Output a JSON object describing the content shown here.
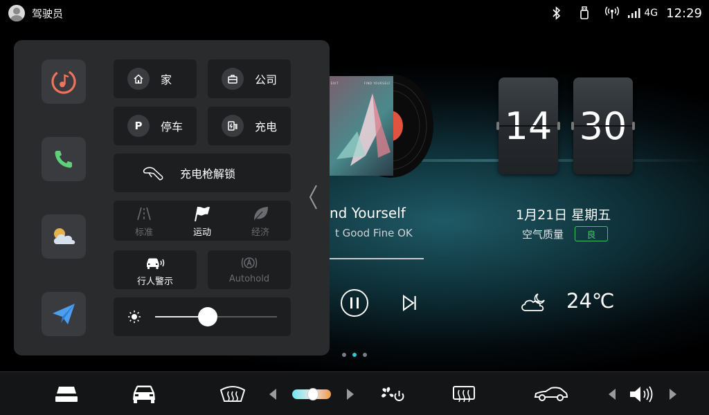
{
  "status_bar": {
    "user_name": "驾驶员",
    "network": "4G",
    "time": "12:29",
    "icons": [
      "bluetooth-icon",
      "usb-drive-icon",
      "wireless-signal-icon",
      "cell-signal-icon"
    ]
  },
  "side_apps": [
    {
      "name": "music-app",
      "icon": "music-disc-icon",
      "color": "#f2735b"
    },
    {
      "name": "phone-app",
      "icon": "phone-icon",
      "color": "#5fd079"
    },
    {
      "name": "weather-app",
      "icon": "cloudy-sun-icon",
      "color": "#e6b24d"
    },
    {
      "name": "navigation-app",
      "icon": "paper-plane-icon",
      "color": "#4e9ef0"
    }
  ],
  "quick_destinations": {
    "home": {
      "label": "家",
      "icon": "home-icon"
    },
    "company": {
      "label": "公司",
      "icon": "briefcase-icon"
    },
    "parking": {
      "label": "停车",
      "glyph": "P"
    },
    "charging": {
      "label": "充电",
      "icon": "charging-station-icon"
    }
  },
  "charge_unlock": {
    "label": "充电枪解锁",
    "icon": "charging-gun-icon"
  },
  "drive_modes": {
    "selected": "运动",
    "items": [
      {
        "label": "标准",
        "icon": "road-icon"
      },
      {
        "label": "运动",
        "icon": "flag-icon"
      },
      {
        "label": "经济",
        "icon": "leaf-icon"
      }
    ]
  },
  "pedestrian_warning": {
    "label": "行人警示",
    "icon": "car-sound-icon"
  },
  "autohold": {
    "label": "Autohold",
    "icon": "autohold-icon"
  },
  "brightness": {
    "icon": "sun-icon",
    "value_fraction": 0.43
  },
  "music": {
    "title": "nd Yourself",
    "artist": "t Good Fine OK",
    "album_text_left": "EXIT",
    "album_text_right": "FIND YOURSELF",
    "progress_fraction": 1.0
  },
  "clock_widget": {
    "hour": "14",
    "minute": "30"
  },
  "date_text": "1月21日  星期五",
  "air_quality": {
    "label": "空气质量",
    "value": "良",
    "color": "#44c16a"
  },
  "weather": {
    "temperature": "24℃",
    "icon": "cloudy-night-icon"
  },
  "page_dots": {
    "count": 3,
    "active": 1,
    "active_color": "#2ec7d6"
  },
  "dock": {
    "items": [
      "home-icon",
      "car-icon",
      "front-defrost-icon",
      "temp-slider",
      "fan-power-icon",
      "rear-defrost-icon",
      "car-side-icon",
      "volume-icon"
    ]
  },
  "colors": {
    "panel_bg": "#2a2b2d",
    "tile_bg": "#1d1e20",
    "accent": "#2ec7d6"
  }
}
